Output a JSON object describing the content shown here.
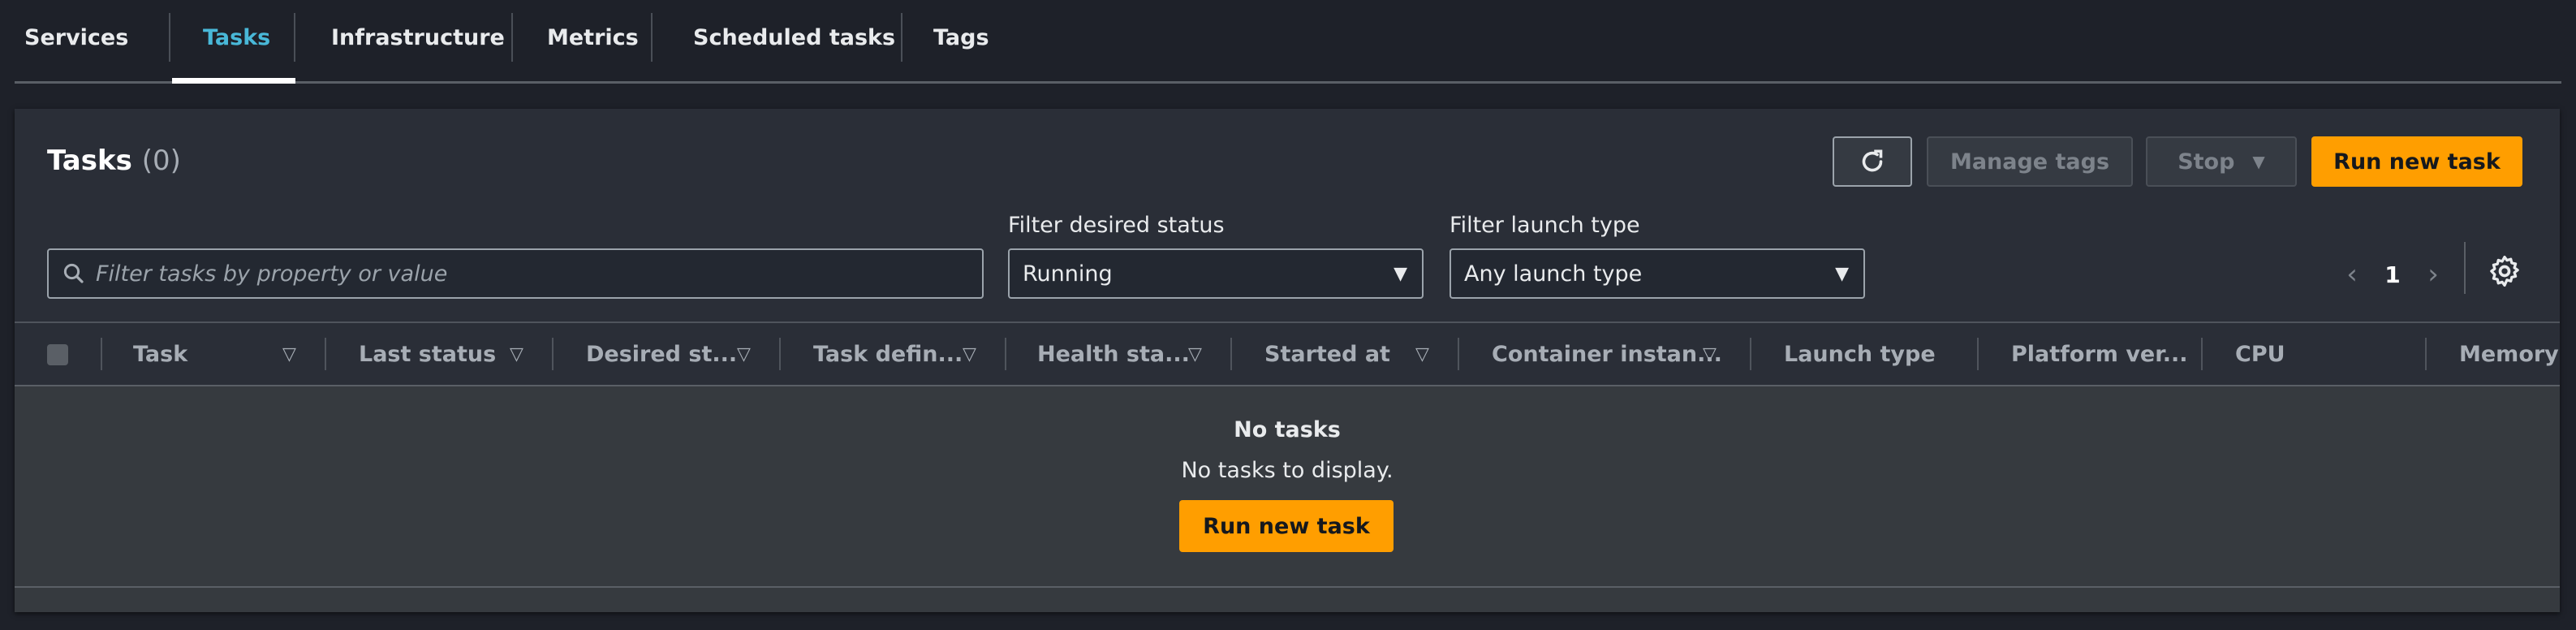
{
  "tabs": [
    {
      "label": "Services",
      "active": false
    },
    {
      "label": "Tasks",
      "active": true
    },
    {
      "label": "Infrastructure",
      "active": false
    },
    {
      "label": "Metrics",
      "active": false
    },
    {
      "label": "Scheduled tasks",
      "active": false
    },
    {
      "label": "Tags",
      "active": false
    }
  ],
  "panel": {
    "title": "Tasks",
    "count": "(0)",
    "actions": {
      "refresh_icon": "refresh-icon",
      "manage_tags": "Manage tags",
      "stop": "Stop",
      "run_new_task": "Run new task"
    }
  },
  "filters": {
    "search_placeholder": "Filter tasks by property or value",
    "desired_status_label": "Filter desired status",
    "desired_status_value": "Running",
    "launch_type_label": "Filter launch type",
    "launch_type_value": "Any launch type"
  },
  "pagination": {
    "current_page": "1",
    "prev_icon": "‹",
    "next_icon": "›"
  },
  "table": {
    "columns": [
      {
        "label": "Task",
        "sortable": true
      },
      {
        "label": "Last status",
        "sortable": true
      },
      {
        "label": "Desired st...",
        "sortable": true
      },
      {
        "label": "Task defin...",
        "sortable": true
      },
      {
        "label": "Health sta...",
        "sortable": true
      },
      {
        "label": "Started at",
        "sortable": true
      },
      {
        "label": "Container instan...",
        "sortable": true
      },
      {
        "label": "Launch type",
        "sortable": false
      },
      {
        "label": "Platform ver...",
        "sortable": false
      },
      {
        "label": "CPU",
        "sortable": false
      },
      {
        "label": "Memory",
        "sortable": false
      }
    ],
    "empty": {
      "title": "No tasks",
      "description": "No tasks to display.",
      "button": "Run new task"
    }
  },
  "colors": {
    "accent": "#49b8d8",
    "primary_button": "#ff9e00",
    "background": "#1e2129",
    "panel": "#2a2e37"
  }
}
